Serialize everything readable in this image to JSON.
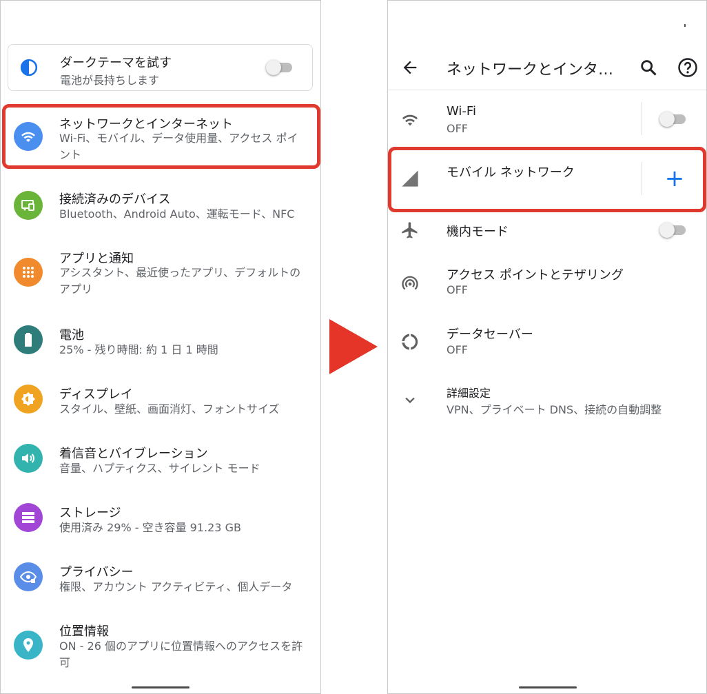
{
  "left": {
    "dark_theme": {
      "title": "ダークテーマを試す",
      "subtitle": "電池が長持ちします",
      "toggle_on": false
    },
    "items": [
      {
        "title": "ネットワークとインターネット",
        "subtitle": "Wi-Fi、モバイル、データ使用量、アクセス ポイント",
        "icon": "wifi-icon",
        "color": "#4a8ef0"
      },
      {
        "title": "接続済みのデバイス",
        "subtitle": "Bluetooth、Android Auto、運転モード、NFC",
        "icon": "devices-icon",
        "color": "#6bb43a"
      },
      {
        "title": "アプリと通知",
        "subtitle": "アシスタント、最近使ったアプリ、デフォルトのアプリ",
        "icon": "apps-grid-icon",
        "color": "#f08a2d"
      },
      {
        "title": "電池",
        "subtitle": "25% - 残り時間: 約 1 日 1 時間",
        "icon": "battery-icon",
        "color": "#2e7d7a"
      },
      {
        "title": "ディスプレイ",
        "subtitle": "スタイル、壁紙、画面消灯、フォントサイズ",
        "icon": "brightness-icon",
        "color": "#f0a320"
      },
      {
        "title": "着信音とバイブレーション",
        "subtitle": "音量、ハプティクス、サイレント モード",
        "icon": "volume-icon",
        "color": "#33b3ad"
      },
      {
        "title": "ストレージ",
        "subtitle": "使用済み 29% - 空き容量 91.23 GB",
        "icon": "storage-icon",
        "color": "#a246d6"
      },
      {
        "title": "プライバシー",
        "subtitle": "権限、アカウント アクティビティ、個人データ",
        "icon": "privacy-eye-icon",
        "color": "#5a8de8"
      },
      {
        "title": "位置情報",
        "subtitle": "ON - 26 個のアプリに位置情報へのアクセスを許可",
        "icon": "location-pin-icon",
        "color": "#3ab4c7"
      }
    ]
  },
  "right": {
    "title": "ネットワークとインタ…",
    "items": [
      {
        "title": "Wi-Fi",
        "subtitle": "OFF",
        "icon": "wifi-icon",
        "control": "toggle",
        "toggle_on": false
      },
      {
        "title": "モバイル ネットワーク",
        "subtitle": "",
        "icon": "signal-icon",
        "control": "add",
        "control_label": "+"
      },
      {
        "title": "機内モード",
        "subtitle": "",
        "icon": "airplane-icon",
        "control": "toggle",
        "toggle_on": false
      },
      {
        "title": "アクセス ポイントとテザリング",
        "subtitle": "OFF",
        "icon": "hotspot-icon"
      },
      {
        "title": "データセーバー",
        "subtitle": "OFF",
        "icon": "data-saver-icon"
      },
      {
        "title": "詳細設定",
        "subtitle": "VPN、プライベート DNS、接続の自動調整",
        "icon": "chevron-down-icon"
      }
    ]
  },
  "colors": {
    "highlight": "#e03a2f",
    "arrow": "#e53528",
    "accent_blue": "#1a73e8",
    "dark_theme_icon": "#1a73e8"
  }
}
